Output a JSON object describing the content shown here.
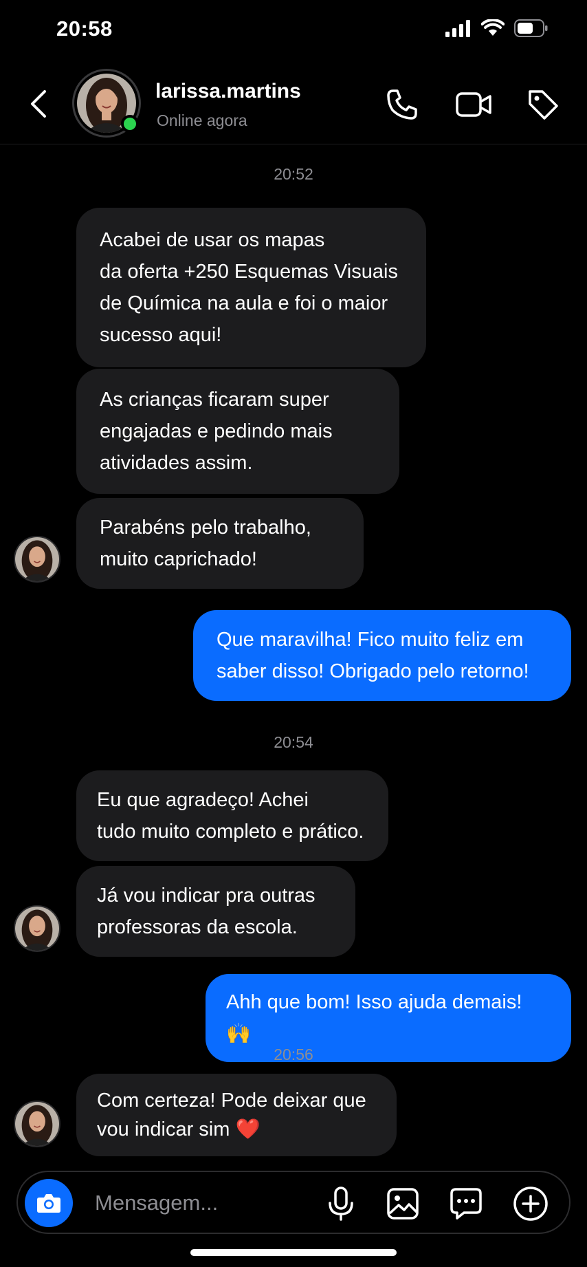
{
  "status_bar": {
    "time": "20:58"
  },
  "header": {
    "contact_name": "larissa.martins",
    "contact_status": "Online agora",
    "icons": [
      "back-icon",
      "phone-icon",
      "video-icon",
      "tag-icon"
    ]
  },
  "thread": {
    "times": [
      "20:52",
      "20:54",
      "20:56"
    ],
    "messages": [
      {
        "from": "contact",
        "text": "Acabei de usar os mapas\nda oferta +250 Esquemas Visuais\nde Química na aula e foi o maior\nsucesso aqui!"
      },
      {
        "from": "contact",
        "text": "As crianças ficaram super\nengajadas e pedindo mais\natividades assim."
      },
      {
        "from": "contact",
        "text": "Parabéns pelo trabalho,\nmuito caprichado!"
      },
      {
        "from": "me",
        "text": "Que maravilha! Fico muito feliz em\nsaber disso! Obrigado pelo retorno!"
      },
      {
        "from": "contact",
        "text": "Eu que agradeço! Achei\ntudo muito completo e prático."
      },
      {
        "from": "contact",
        "text": "Já vou indicar pra outras\nprofessoras da escola."
      },
      {
        "from": "me",
        "text": "Ahh que bom! Isso ajuda demais! 🙌"
      },
      {
        "from": "contact",
        "text": "Com certeza! Pode deixar que\nvou indicar sim ❤️"
      }
    ]
  },
  "composer": {
    "placeholder": "Mensagem...",
    "icons": [
      "camera-icon",
      "microphone-icon",
      "image-icon",
      "sticker-icon",
      "plus-icon"
    ]
  },
  "colors": {
    "accent": "#0a6cff",
    "incoming_bubble": "#1c1c1e",
    "online": "#2bd34f",
    "background": "#000000"
  }
}
